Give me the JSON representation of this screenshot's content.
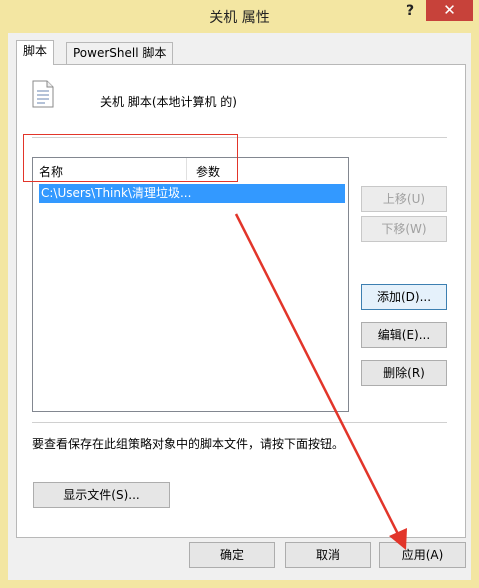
{
  "window": {
    "title": "关机 属性",
    "help": "?",
    "close": "✕"
  },
  "tabs": [
    {
      "label": "脚本"
    },
    {
      "label": "PowerShell 脚本"
    }
  ],
  "header": {
    "icon": "script-icon",
    "text": "关机 脚本(本地计算机 的)"
  },
  "list": {
    "columns": [
      "名称",
      "参数"
    ],
    "rows": [
      {
        "name": "C:\\Users\\Think\\清理垃圾...",
        "params": ""
      }
    ]
  },
  "side_buttons": {
    "up": "上移(U)",
    "down": "下移(W)",
    "add": "添加(D)...",
    "edit": "编辑(E)...",
    "delete": "删除(R)"
  },
  "hint": "要查看保存在此组策略对象中的脚本文件，请按下面按钮。",
  "show_files": "显示文件(S)...",
  "footer": {
    "ok": "确定",
    "cancel": "取消",
    "apply": "应用(A)"
  },
  "colors": {
    "titlebar": "#f3e6a2",
    "close": "#c7423a",
    "selection": "#3399ff",
    "annotation": "#e2352a"
  }
}
